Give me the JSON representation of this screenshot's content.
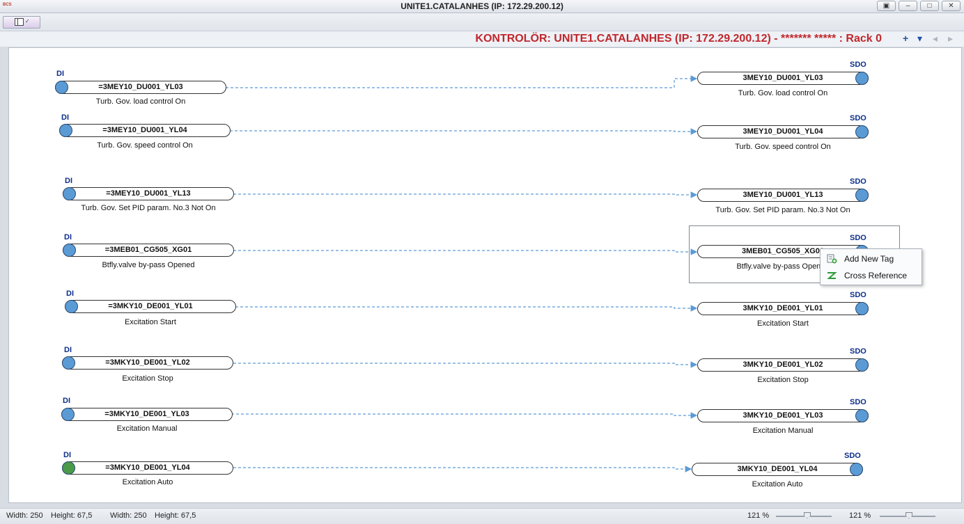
{
  "window": {
    "title": "UNITE1.CATALANHES (IP: 172.29.200.12)",
    "logo_text": "BCS",
    "controls": {
      "restore": "▣",
      "minimize": "–",
      "maximize": "□",
      "close": "✕"
    }
  },
  "header": {
    "controller_title": "KONTROLÖR: UNITE1.CATALANHES (IP: 172.29.200.12) - ******* ***** : Rack 0",
    "icons": {
      "add": "+",
      "dropdown": "▾",
      "prev": "◂",
      "next": "▸"
    }
  },
  "inputs": [
    {
      "type": "DI",
      "tag": "=3MEY10_DU001_YL03",
      "desc": "Turb. Gov. load control On"
    },
    {
      "type": "DI",
      "tag": "=3MEY10_DU001_YL04",
      "desc": "Turb. Gov. speed control On"
    },
    {
      "type": "DI",
      "tag": "=3MEY10_DU001_YL13",
      "desc": "Turb. Gov. Set PID param. No.3 Not On"
    },
    {
      "type": "DI",
      "tag": "=3MEB01_CG505_XG01",
      "desc": "Btfly.valve by-pass Opened"
    },
    {
      "type": "DI",
      "tag": "=3MKY10_DE001_YL01",
      "desc": "Excitation Start"
    },
    {
      "type": "DI",
      "tag": "=3MKY10_DE001_YL02",
      "desc": "Excitation Stop"
    },
    {
      "type": "DI",
      "tag": "=3MKY10_DE001_YL03",
      "desc": "Excitation Manual"
    },
    {
      "type": "DI",
      "tag": "=3MKY10_DE001_YL04",
      "desc": "Excitation Auto"
    }
  ],
  "outputs": [
    {
      "type": "SDO",
      "tag": "3MEY10_DU001_YL03",
      "desc": "Turb. Gov. load control On"
    },
    {
      "type": "SDO",
      "tag": "3MEY10_DU001_YL04",
      "desc": "Turb. Gov. speed control On"
    },
    {
      "type": "SDO",
      "tag": "3MEY10_DU001_YL13",
      "desc": "Turb. Gov. Set PID param. No.3 Not On"
    },
    {
      "type": "SDO",
      "tag": "3MEB01_CG505_XG01",
      "desc": "Btfly.valve by-pass Opened"
    },
    {
      "type": "SDO",
      "tag": "3MKY10_DE001_YL01",
      "desc": "Excitation Start"
    },
    {
      "type": "SDO",
      "tag": "3MKY10_DE001_YL02",
      "desc": "Excitation Stop"
    },
    {
      "type": "SDO",
      "tag": "3MKY10_DE001_YL03",
      "desc": "Excitation Manual"
    },
    {
      "type": "SDO",
      "tag": "3MKY10_DE001_YL04",
      "desc": "Excitation Auto"
    }
  ],
  "context_menu": {
    "add_new_tag": "Add New Tag",
    "cross_reference": "Cross Reference"
  },
  "statusbar": {
    "width_label_1": "Width: 250",
    "height_label_1": "Height: 67,5",
    "width_label_2": "Width: 250",
    "height_label_2": "Height: 67,5",
    "zoom_1": "121 %",
    "zoom_2": "121 %"
  },
  "colors": {
    "port": "#5b9bd5",
    "wire": "#5b9bd5",
    "title_red": "#c0272d",
    "type_label": "#0c2e8a"
  }
}
